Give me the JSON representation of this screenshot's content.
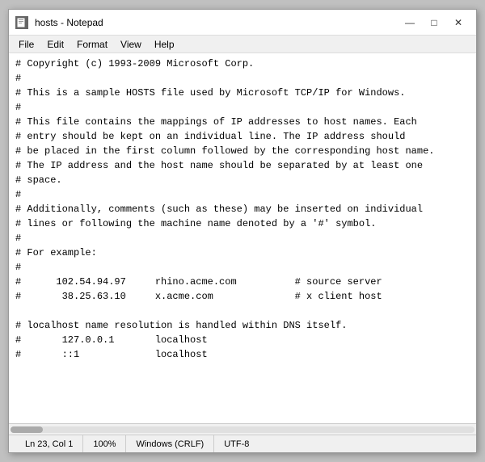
{
  "window": {
    "title": "hosts - Notepad",
    "icon": "📄"
  },
  "titlebar": {
    "minimize": "—",
    "maximize": "□",
    "close": "✕"
  },
  "menu": {
    "items": [
      "File",
      "Edit",
      "Format",
      "View",
      "Help"
    ]
  },
  "editor": {
    "content": "# Copyright (c) 1993-2009 Microsoft Corp.\n#\n# This is a sample HOSTS file used by Microsoft TCP/IP for Windows.\n#\n# This file contains the mappings of IP addresses to host names. Each\n# entry should be kept on an individual line. The IP address should\n# be placed in the first column followed by the corresponding host name.\n# The IP address and the host name should be separated by at least one\n# space.\n#\n# Additionally, comments (such as these) may be inserted on individual\n# lines or following the machine name denoted by a '#' symbol.\n#\n# For example:\n#\n#      102.54.94.97     rhino.acme.com          # source server\n#       38.25.63.10     x.acme.com              # x client host\n\n# localhost name resolution is handled within DNS itself.\n#       127.0.0.1       localhost\n#       ::1             localhost\n"
  },
  "statusbar": {
    "position": "Ln 23, Col 1",
    "zoom": "100%",
    "line_ending": "Windows (CRLF)",
    "encoding": "UTF-8"
  }
}
